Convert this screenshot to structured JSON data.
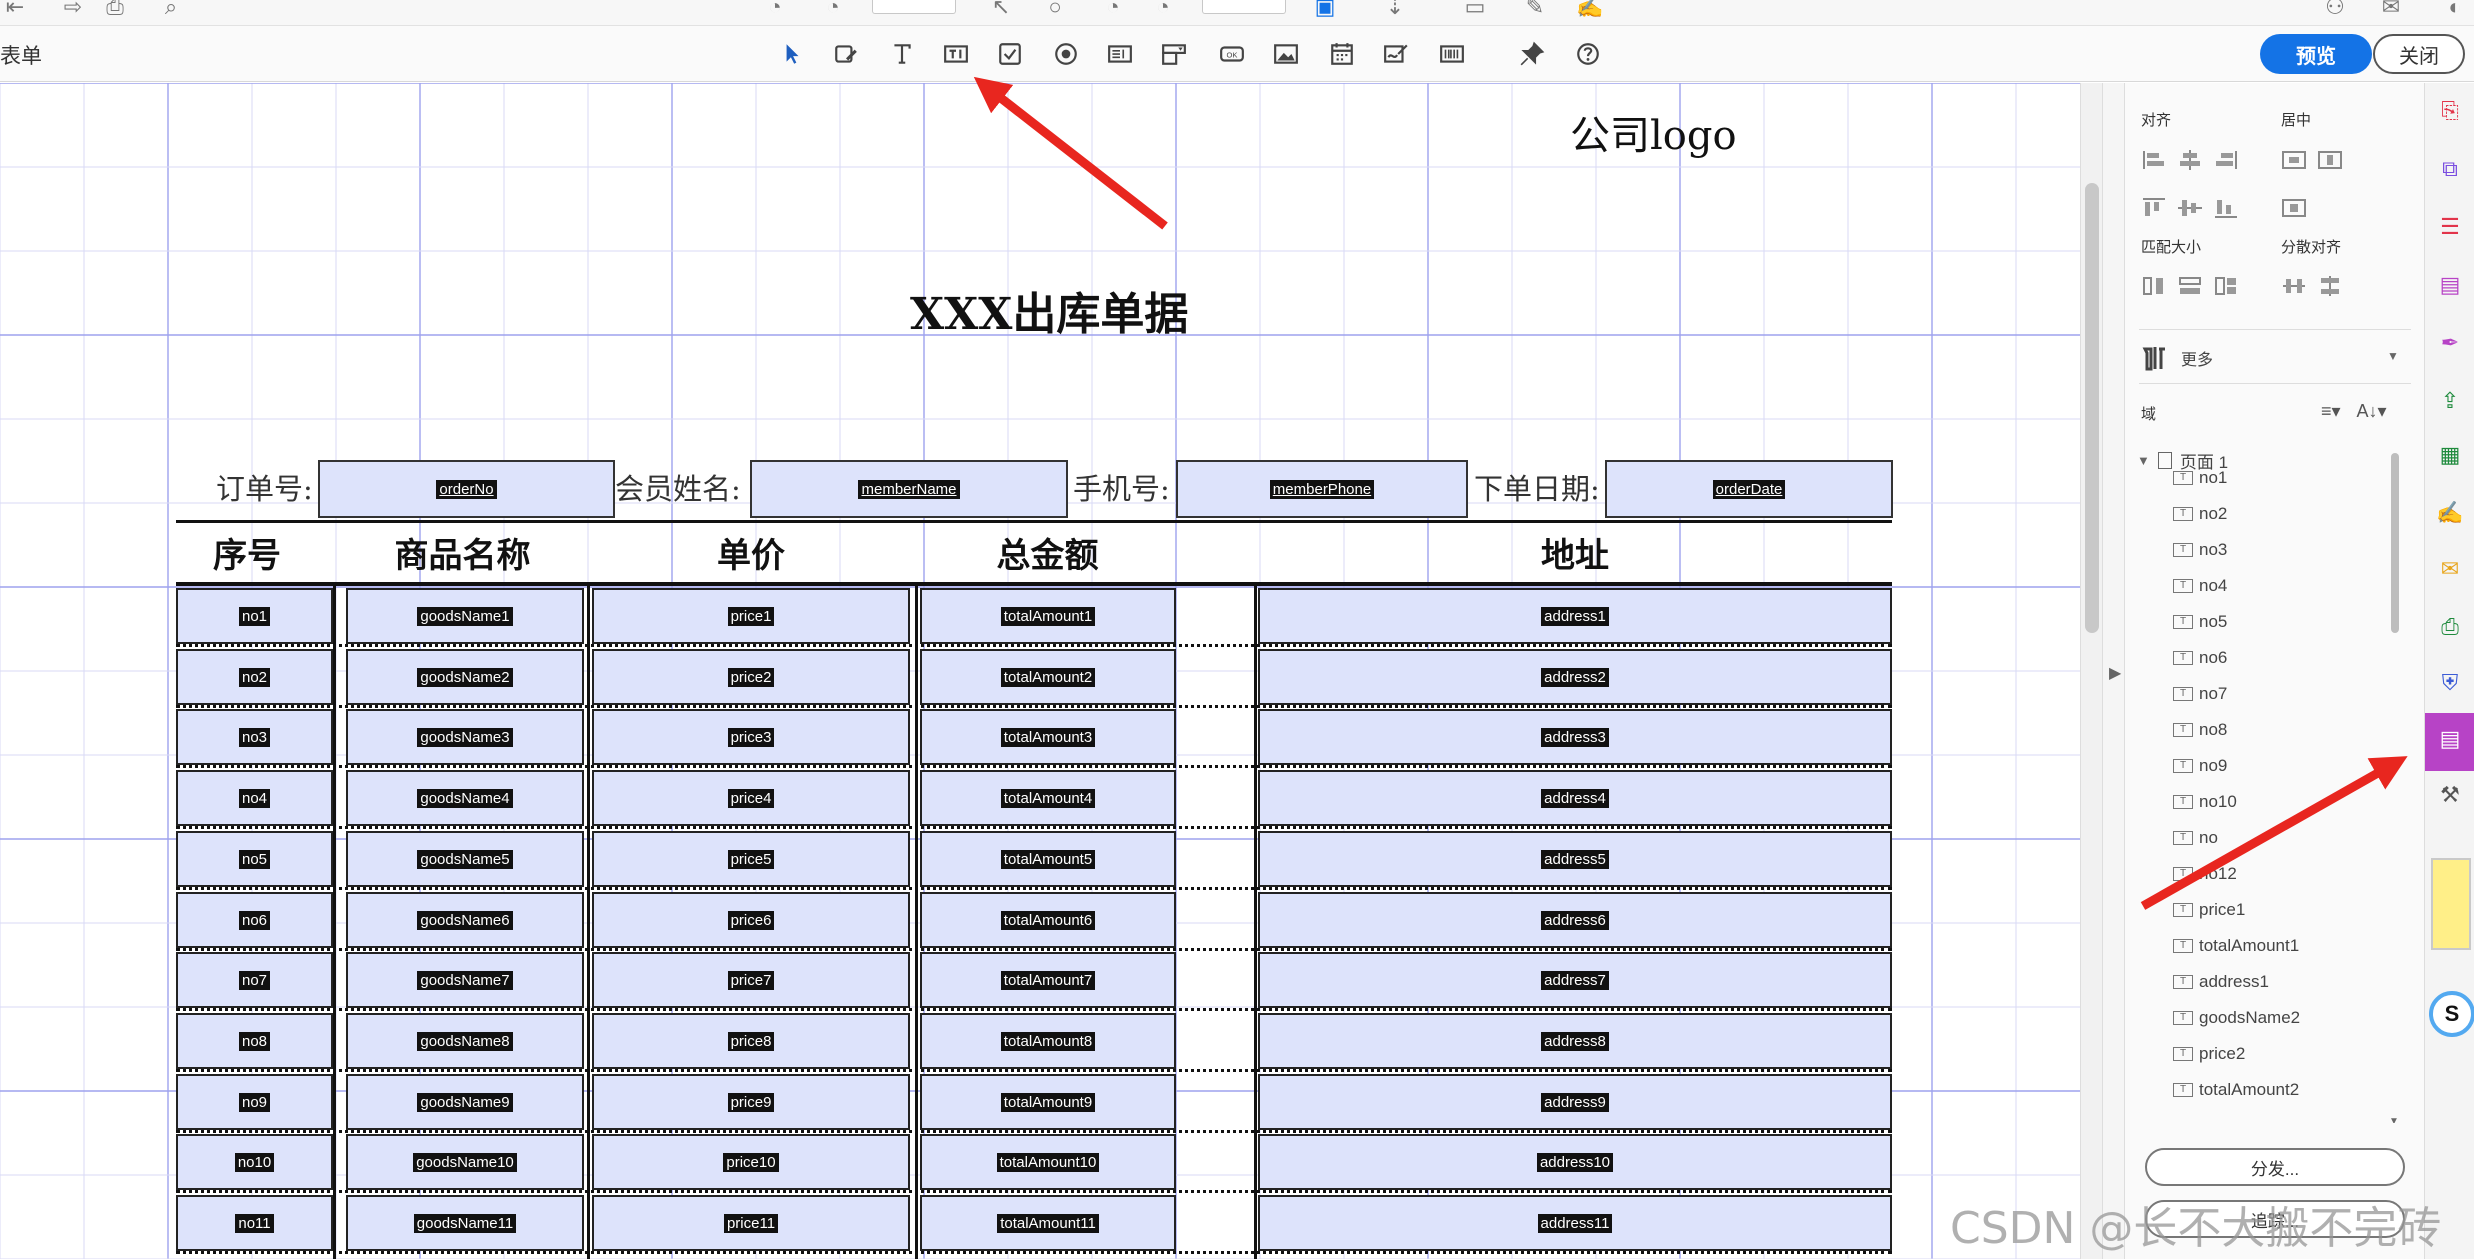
{
  "toolbar": {
    "tool_name": "表单",
    "tools": [
      "select-arrow-icon",
      "edit-form-icon",
      "text-tool-icon",
      "text-field-icon",
      "checkbox-icon",
      "radio-button-icon",
      "list-box-icon",
      "dropdown-icon",
      "button-icon",
      "image-field-icon",
      "date-field-icon",
      "signature-icon",
      "barcode-icon",
      "pin-icon",
      "help-icon"
    ],
    "preview_label": "预览",
    "close_label": "关闭"
  },
  "document": {
    "logo_text": "公司logo",
    "title": "XXX出库单据",
    "header_fields": [
      {
        "label": "订单号:",
        "field": "orderNo"
      },
      {
        "label": "会员姓名:",
        "field": "memberName"
      },
      {
        "label": "手机号:",
        "field": "memberPhone"
      },
      {
        "label": "下单日期:",
        "field": "orderDate"
      }
    ],
    "columns": [
      "序号",
      "商品名称",
      "单价",
      "总金额",
      "地址"
    ],
    "rows": [
      [
        "no1",
        "goodsName1",
        "price1",
        "totalAmount1",
        "address1"
      ],
      [
        "no2",
        "goodsName2",
        "price2",
        "totalAmount2",
        "address2"
      ],
      [
        "no3",
        "goodsName3",
        "price3",
        "totalAmount3",
        "address3"
      ],
      [
        "no4",
        "goodsName4",
        "price4",
        "totalAmount4",
        "address4"
      ],
      [
        "no5",
        "goodsName5",
        "price5",
        "totalAmount5",
        "address5"
      ],
      [
        "no6",
        "goodsName6",
        "price6",
        "totalAmount6",
        "address6"
      ],
      [
        "no7",
        "goodsName7",
        "price7",
        "totalAmount7",
        "address7"
      ],
      [
        "no8",
        "goodsName8",
        "price8",
        "totalAmount8",
        "address8"
      ],
      [
        "no9",
        "goodsName9",
        "price9",
        "totalAmount9",
        "address9"
      ],
      [
        "no10",
        "goodsName10",
        "price10",
        "totalAmount10",
        "address10"
      ],
      [
        "no11",
        "goodsName11",
        "price11",
        "totalAmount11",
        "address11"
      ]
    ]
  },
  "right_panel": {
    "align_title": "对齐",
    "center_title": "居中",
    "match_size_title": "匹配大小",
    "distribute_title": "分散对齐",
    "more_label": "更多",
    "fields_title": "域",
    "page_node": "页面 1",
    "tree_items": [
      "no1",
      "no2",
      "no3",
      "no4",
      "no5",
      "no6",
      "no7",
      "no8",
      "no9",
      "no10",
      "no",
      "no12",
      "price1",
      "totalAmount1",
      "address1",
      "goodsName2",
      "price2",
      "totalAmount2"
    ],
    "distribute_button": "分发...",
    "track_button": "追踪..."
  },
  "rail": {
    "icons": [
      "create-pdf-icon",
      "combine-files-icon",
      "organize-pages-icon",
      "edit-pdf-icon",
      "fill-sign-icon",
      "export-pdf-icon",
      "excel-icon",
      "request-signature-icon",
      "comment-icon",
      "print-production-icon",
      "protect-icon",
      "prepare-form-icon",
      "more-tools-icon"
    ]
  },
  "watermark": "CSDN @长不大搬不完砖",
  "colors": {
    "accent": "#1473e6",
    "field_fill": "#dde3fb",
    "grid_line": "#b4b7f1",
    "arrow": "#e8261f",
    "rail_active": "#b743c6"
  }
}
